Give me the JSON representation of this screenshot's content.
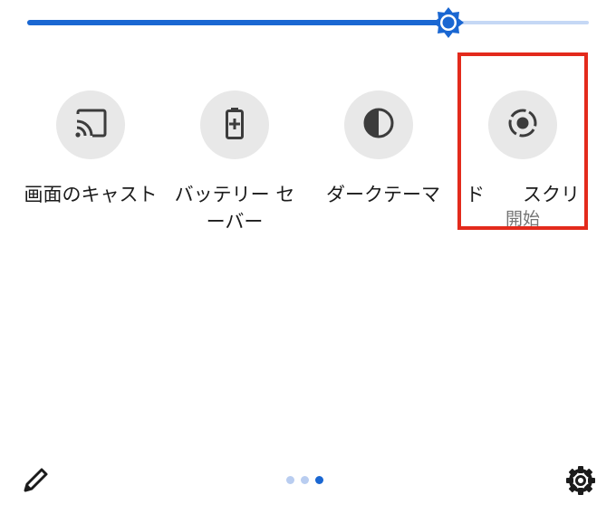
{
  "brightness": {
    "level": 0.75,
    "color_active": "#1a67d2",
    "color_inactive": "#c5d8f5",
    "icon": "brightness-icon"
  },
  "tiles": [
    {
      "icon": "cast-icon",
      "label": "画面のキャスト",
      "sub": ""
    },
    {
      "icon": "battery-saver-icon",
      "label": "バッテリー セ\nーバー",
      "sub": ""
    },
    {
      "icon": "dark-theme-icon",
      "label": "ダークテーマ",
      "sub": ""
    },
    {
      "icon": "screen-record-icon",
      "label": "ド　　スクリ",
      "sub": "開始"
    }
  ],
  "highlight_color": "#e32a1c",
  "footer": {
    "edit_icon": "pencil-icon",
    "settings_icon": "gear-icon",
    "page_count": 3,
    "active_page": 3
  }
}
